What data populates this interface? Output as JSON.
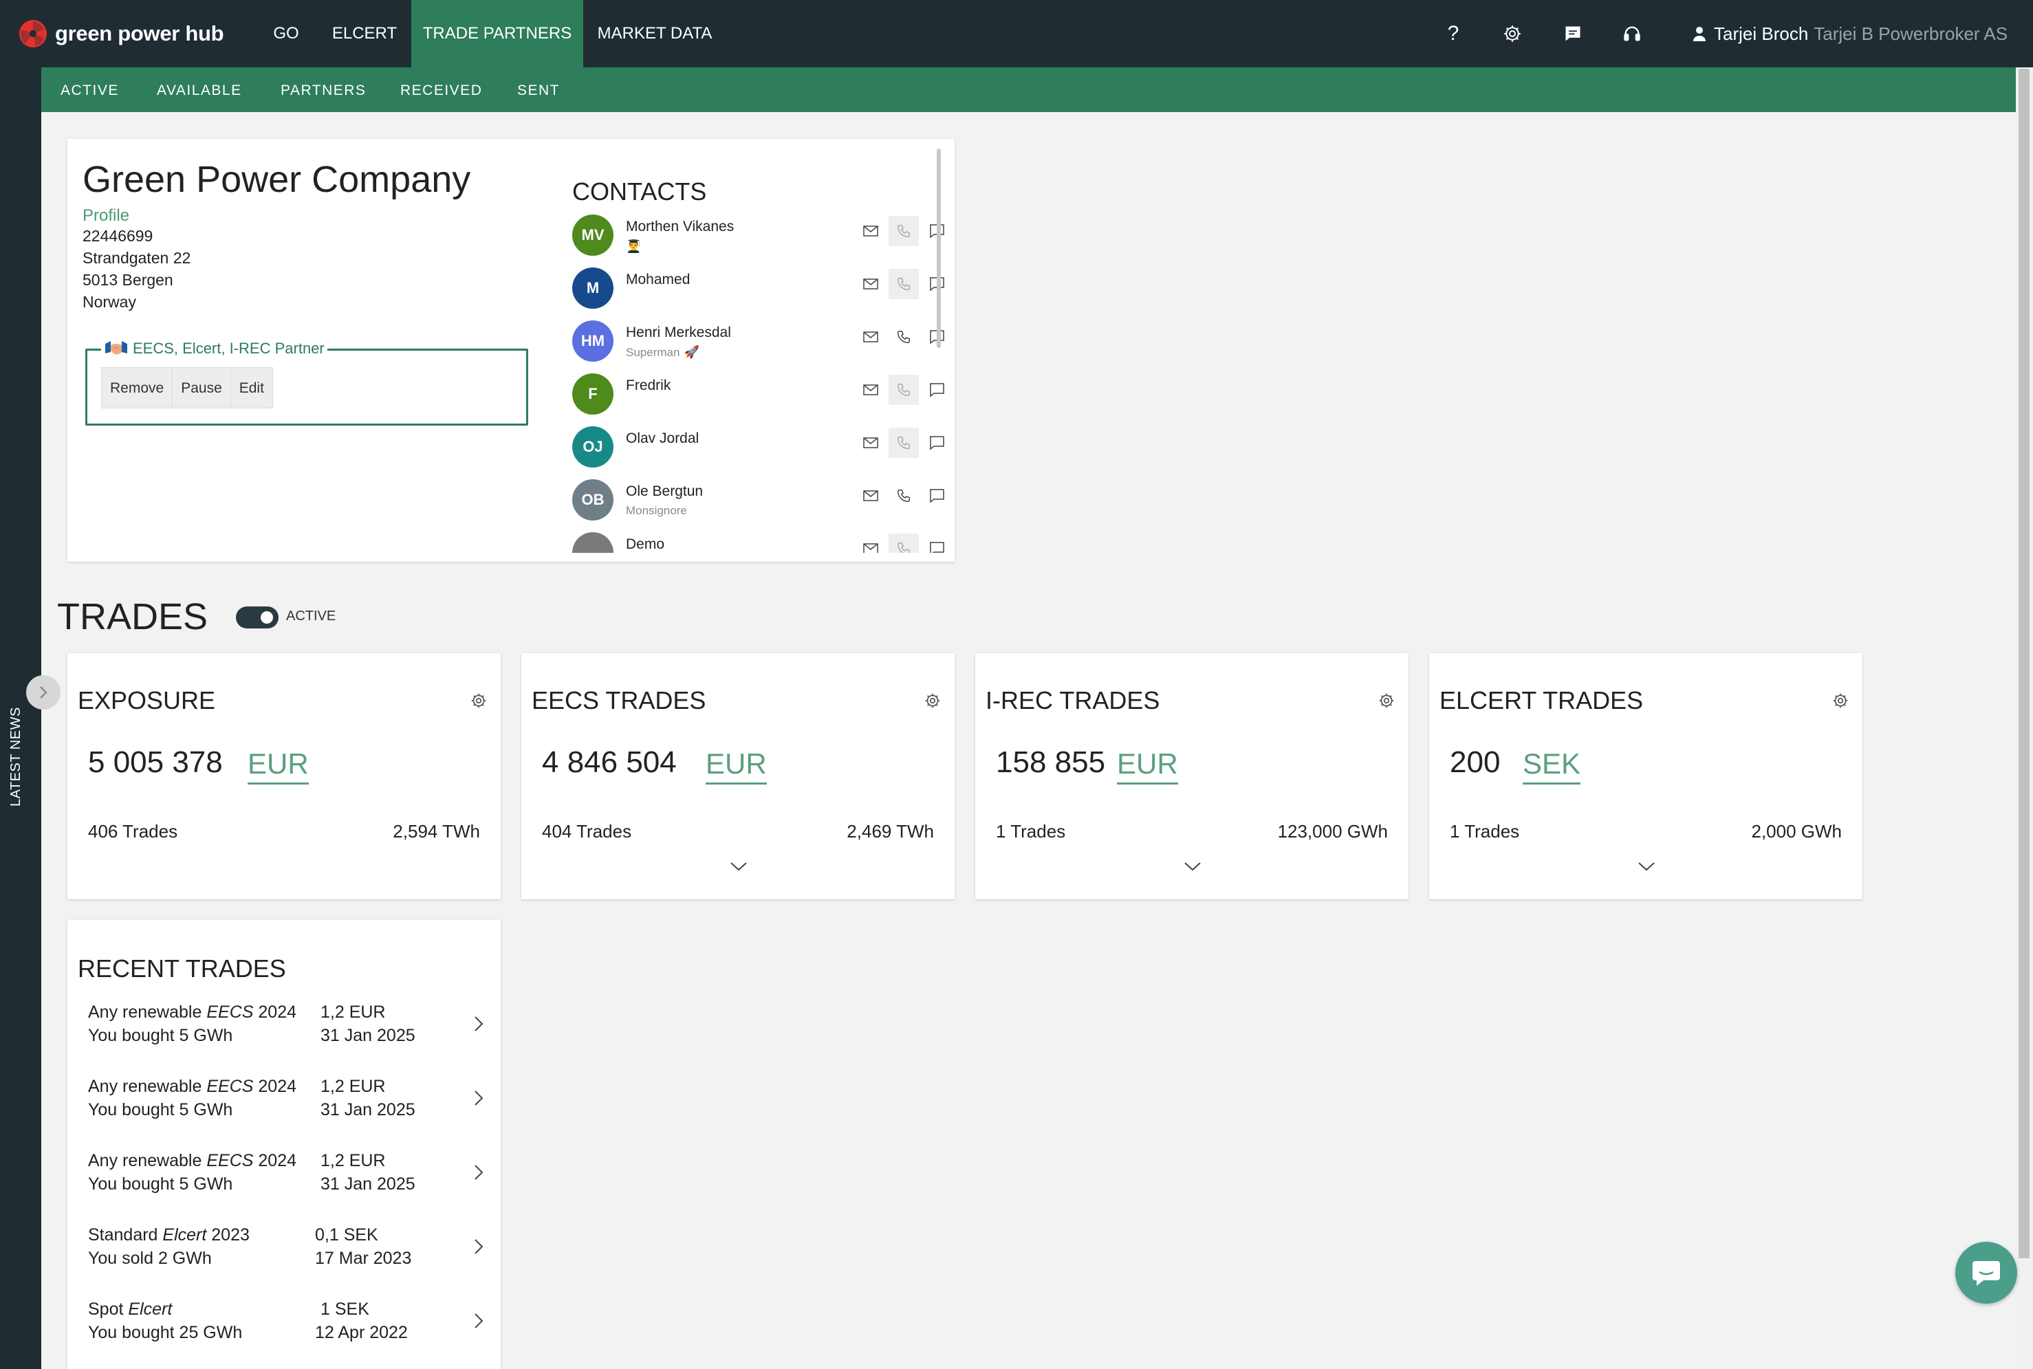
{
  "app": {
    "brand": "green power hub"
  },
  "topnav": {
    "items": [
      {
        "label": "GO"
      },
      {
        "label": "ELCERT"
      },
      {
        "label": "TRADE PARTNERS"
      },
      {
        "label": "MARKET DATA"
      }
    ],
    "active": "TRADE PARTNERS",
    "help_label": "?",
    "icons": [
      "help-icon",
      "gear-icon",
      "chat-icon",
      "headset-icon",
      "user-icon"
    ]
  },
  "user": {
    "name": "Tarjei Broch",
    "company": "Tarjei B Powerbroker AS"
  },
  "subnav": {
    "items": [
      {
        "label": "ACTIVE"
      },
      {
        "label": "AVAILABLE"
      },
      {
        "label": "PARTNERS"
      },
      {
        "label": "RECEIVED"
      },
      {
        "label": "SENT"
      }
    ]
  },
  "sidebar": {
    "latest_news": "LATEST NEWS"
  },
  "partner": {
    "name": "Green Power Company",
    "profile_link": "Profile",
    "org_number": "22446699",
    "street": "Strandgaten 22",
    "city": "5013 Bergen",
    "country": "Norway",
    "partnership": "EECS, Elcert, I-REC Partner",
    "buttons": {
      "remove": "Remove",
      "pause": "Pause",
      "edit": "Edit"
    }
  },
  "contacts": {
    "title": "CONTACTS",
    "items": [
      {
        "initials": "MV",
        "name": "Morthen Vikanes",
        "role": "",
        "emoji": "👨‍🎓",
        "avatar_color": "#4e8a1c",
        "phone_enabled": false
      },
      {
        "initials": "M",
        "name": "Mohamed",
        "role": "",
        "emoji": "",
        "avatar_color": "#164a8c",
        "phone_enabled": false
      },
      {
        "initials": "HM",
        "name": "Henri Merkesdal",
        "role": "Superman",
        "emoji": "🚀",
        "avatar_color": "#5b6fe0",
        "phone_enabled": true
      },
      {
        "initials": "F",
        "name": "Fredrik",
        "role": "",
        "emoji": "",
        "avatar_color": "#4e8a1c",
        "phone_enabled": false
      },
      {
        "initials": "OJ",
        "name": "Olav Jordal",
        "role": "",
        "emoji": "",
        "avatar_color": "#178a86",
        "phone_enabled": false
      },
      {
        "initials": "OB",
        "name": "Ole Bergtun",
        "role": "Monsignore",
        "emoji": "",
        "avatar_color": "#6f7f88",
        "phone_enabled": true
      },
      {
        "initials": "",
        "name": "Demo",
        "role": "",
        "emoji": "",
        "avatar_color": "#7a7a7a",
        "phone_enabled": false
      }
    ]
  },
  "trades": {
    "title": "TRADES",
    "toggle_label": "ACTIVE",
    "toggle_on": true,
    "cards": [
      {
        "title": "EXPOSURE",
        "value": "5 005 378",
        "currency": "EUR",
        "trades": "406 Trades",
        "energy": "2,594 TWh",
        "expandable": false
      },
      {
        "title": "EECS TRADES",
        "value": "4 846 504",
        "currency": "EUR",
        "trades": "404 Trades",
        "energy": "2,469 TWh",
        "expandable": true
      },
      {
        "title": "I-REC TRADES",
        "value": "158 855",
        "currency": "EUR",
        "trades": "1 Trades",
        "energy": "123,000 GWh",
        "expandable": true
      },
      {
        "title": "ELCERT TRADES",
        "value": "200",
        "currency": "SEK",
        "trades": "1 Trades",
        "energy": "2,000 GWh",
        "expandable": true
      }
    ]
  },
  "recent_trades": {
    "title": "RECENT TRADES",
    "items": [
      {
        "product_prefix": "Any renewable",
        "product_type": "EECS",
        "product_year": "2024",
        "action": "You bought 5 GWh",
        "price": "1,2 EUR",
        "date": "31 Jan 2025"
      },
      {
        "product_prefix": "Any renewable",
        "product_type": "EECS",
        "product_year": "2024",
        "action": "You bought 5 GWh",
        "price": "1,2 EUR",
        "date": "31 Jan 2025"
      },
      {
        "product_prefix": "Any renewable",
        "product_type": "EECS",
        "product_year": "2024",
        "action": "You bought 5 GWh",
        "price": "1,2 EUR",
        "date": "31 Jan 2025"
      },
      {
        "product_prefix": "Standard",
        "product_type": "Elcert",
        "product_year": "2023",
        "action": "You sold 2 GWh",
        "price": "0,1 SEK",
        "date": "17 Mar 2023"
      },
      {
        "product_prefix": "Spot",
        "product_type": "Elcert",
        "product_year": "",
        "action": "You bought 25 GWh",
        "price": "1 SEK",
        "date": "12 Apr 2022"
      }
    ]
  },
  "colors": {
    "topbar": "#1f2d33",
    "accent": "#2e7d5b",
    "currency": "#5a9f7e",
    "chat_fab": "#4a9e8a"
  }
}
